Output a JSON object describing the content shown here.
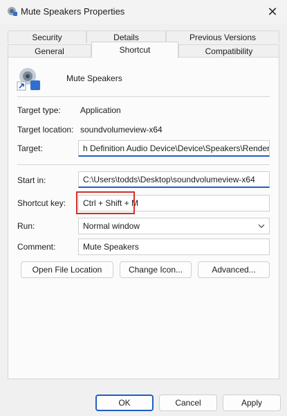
{
  "window": {
    "title": "Mute Speakers Properties",
    "close_glyph": "✕"
  },
  "tabs": {
    "row1": [
      "Security",
      "Details",
      "Previous Versions"
    ],
    "row2": [
      "General",
      "Shortcut",
      "Compatibility"
    ],
    "active": "Shortcut"
  },
  "shortcut": {
    "name": "Mute Speakers",
    "target_type_label": "Target type:",
    "target_type_value": "Application",
    "target_location_label": "Target location:",
    "target_location_value": "soundvolumeview-x64",
    "target_label": "Target:",
    "target_value": "h Definition Audio Device\\Device\\Speakers\\Render\"",
    "start_in_label": "Start in:",
    "start_in_value": "C:\\Users\\todds\\Desktop\\soundvolumeview-x64",
    "shortcut_key_label": "Shortcut key:",
    "shortcut_key_value": "Ctrl + Shift + M",
    "run_label": "Run:",
    "run_value": "Normal window",
    "comment_label": "Comment:",
    "comment_value": "Mute Speakers"
  },
  "actions": {
    "open_file_location": "Open File Location",
    "change_icon": "Change Icon...",
    "advanced": "Advanced..."
  },
  "dialog_buttons": {
    "ok": "OK",
    "cancel": "Cancel",
    "apply": "Apply"
  },
  "colors": {
    "accent": "#1f5fbf",
    "highlight": "#d0302b"
  }
}
